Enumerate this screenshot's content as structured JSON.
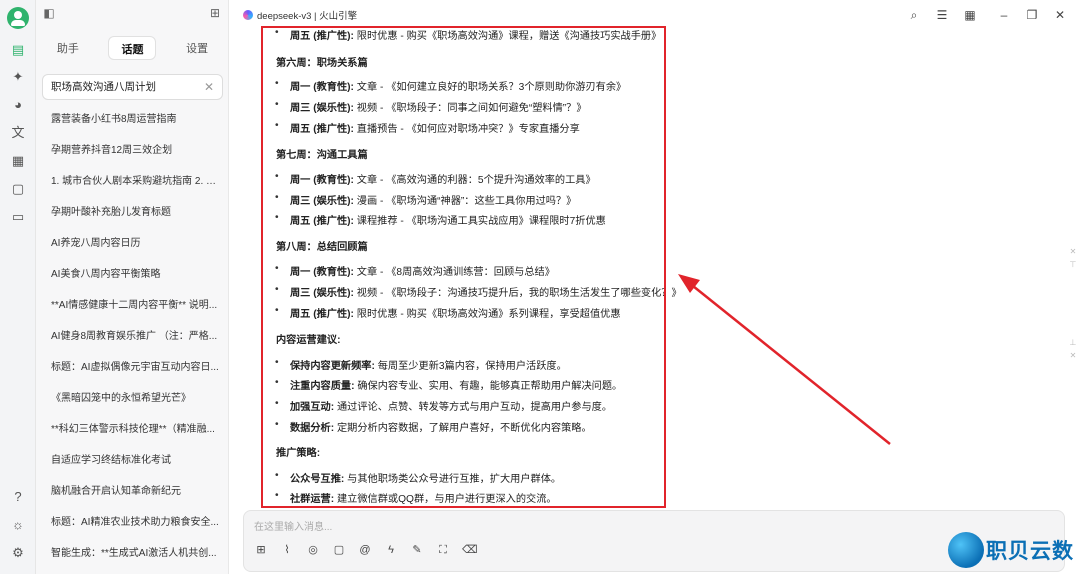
{
  "sidebar": {
    "tabs": [
      "助手",
      "话题",
      "设置"
    ],
    "search_value": "职场高效沟通八周计划",
    "items": [
      "露营装备小红书8周运营指南",
      "孕期营养抖音12周三效企划",
      "1. 城市合伙人剧本采购避坑指南 2. 剧...",
      "孕期叶酸补充胎儿发育标题",
      "AI养宠八周内容日历",
      "AI美食八周内容平衡策略",
      "**AI情感健康十二周内容平衡** 说明...",
      "AI健身8周教育娱乐推广 （注：严格...",
      "标题：AI虚拟偶像元宇宙互动内容日...",
      "《黑暗囚笼中的永恒希望光芒》",
      "**科幻三体警示科技伦理**（精准融...",
      "自适应学习终结标准化考试",
      "脑机融合开启认知革命新纪元",
      "标题：AI精准农业技术助力粮食安全...",
      "智能生成：**生成式AI激活人机共创..."
    ]
  },
  "header": {
    "title": "deepseek-v3 | 火山引擎"
  },
  "content": {
    "lines": [
      {
        "kind": "b",
        "bold": "周五 (推广性):",
        "text": " 限时优惠 - 购买《职场高效沟通》课程，赠送《沟通技巧实战手册》"
      },
      {
        "kind": "h",
        "text": "第六周：职场关系篇"
      },
      {
        "kind": "b",
        "bold": "周一 (教育性):",
        "text": " 文章 - 《如何建立良好的职场关系？3个原则助你游刃有余》"
      },
      {
        "kind": "b",
        "bold": "周三 (娱乐性):",
        "text": " 视频 - 《职场段子：同事之间如何避免“塑料情”？》"
      },
      {
        "kind": "b",
        "bold": "周五 (推广性):",
        "text": " 直播预告 - 《如何应对职场冲突？》专家直播分享"
      },
      {
        "kind": "h",
        "text": "第七周：沟通工具篇"
      },
      {
        "kind": "b",
        "bold": "周一 (教育性):",
        "text": " 文章 - 《高效沟通的利器：5个提升沟通效率的工具》"
      },
      {
        "kind": "b",
        "bold": "周三 (娱乐性):",
        "text": " 漫画 - 《职场沟通“神器”：这些工具你用过吗？》"
      },
      {
        "kind": "b",
        "bold": "周五 (推广性):",
        "text": " 课程推荐 - 《职场沟通工具实战应用》课程限时7折优惠"
      },
      {
        "kind": "h",
        "text": "第八周：总结回顾篇"
      },
      {
        "kind": "b",
        "bold": "周一 (教育性):",
        "text": " 文章 - 《8周高效沟通训练营：回顾与总结》"
      },
      {
        "kind": "b",
        "bold": "周三 (娱乐性):",
        "text": " 视频 - 《职场段子：沟通技巧提升后，我的职场生活发生了哪些变化？》"
      },
      {
        "kind": "b",
        "bold": "周五 (推广性):",
        "text": " 限时优惠 - 购买《职场高效沟通》系列课程，享受超值优惠"
      },
      {
        "kind": "h",
        "text": "内容运营建议:"
      },
      {
        "kind": "b",
        "bold": "保持内容更新频率:",
        "text": " 每周至少更新3篇内容，保持用户活跃度。"
      },
      {
        "kind": "b",
        "bold": "注重内容质量:",
        "text": " 确保内容专业、实用、有趣，能够真正帮助用户解决问题。"
      },
      {
        "kind": "b",
        "bold": "加强互动:",
        "text": " 通过评论、点赞、转发等方式与用户互动，提高用户参与度。"
      },
      {
        "kind": "b",
        "bold": "数据分析:",
        "text": " 定期分析内容数据，了解用户喜好，不断优化内容策略。"
      },
      {
        "kind": "h",
        "text": "推广策略:"
      },
      {
        "kind": "b",
        "bold": "公众号互推:",
        "text": " 与其他职场类公众号进行互推，扩大用户群体。"
      },
      {
        "kind": "b",
        "bold": "社群运营:",
        "text": " 建立微信群或QQ群，与用户进行更深入的交流。"
      }
    ]
  },
  "input": {
    "placeholder": "在这里输入消息..."
  },
  "watermark": {
    "text": "职贝云数"
  },
  "colors": {
    "accent": "#2fb36d",
    "highlight_border": "#e1242b",
    "arrow": "#e1242b",
    "watermark": "#0b6fb5"
  }
}
